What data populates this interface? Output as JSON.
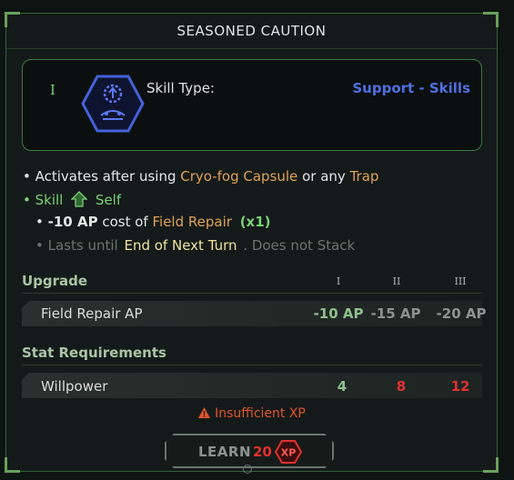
{
  "title": "SEASONED CAUTION",
  "header": {
    "rank": "I",
    "skill_type_label": "Skill Type:",
    "skill_type_value": "Support - Skills",
    "icon": "cog-shield-icon"
  },
  "effects": {
    "line1": {
      "bullet": "•",
      "prefix": "Activates after using",
      "item1": "Cryo-fog Capsule",
      "mid": "or any",
      "item2": "Trap"
    },
    "line2": {
      "bullet": "•",
      "skill": "Skill",
      "target": "Self",
      "icon": "up-arrow-icon"
    },
    "line3": {
      "bullet": "•",
      "value": "-10 AP",
      "text": "cost of",
      "skill": "Field Repair",
      "mult": "(x1)"
    },
    "line4": {
      "bullet": "•",
      "prefix": "Lasts until",
      "duration": "End of Next Turn",
      "suffix": ". Does not Stack"
    }
  },
  "upgrade": {
    "header": "Upgrade",
    "levels": [
      "I",
      "II",
      "III"
    ],
    "row_label": "Field Repair AP",
    "values": [
      "-10 AP",
      "-15 AP",
      "-20 AP"
    ]
  },
  "requirements": {
    "header": "Stat Requirements",
    "row_label": "Willpower",
    "values": [
      "4",
      "8",
      "12"
    ]
  },
  "warning": {
    "icon": "warning-icon",
    "text": "Insufficient XP"
  },
  "learn": {
    "label": "LEARN",
    "cost": "20",
    "unit": "XP"
  },
  "colors": {
    "accent_green": "#7ccf7a",
    "skill_blue": "#4f6fe0",
    "orange": "#e0a25a",
    "red": "#e0312f"
  }
}
